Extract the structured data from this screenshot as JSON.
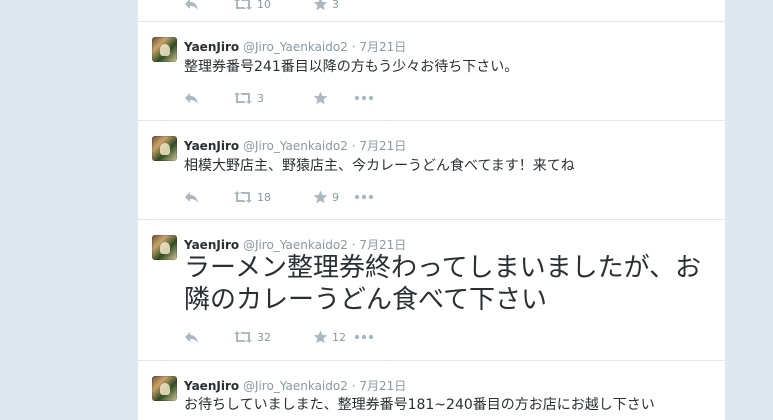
{
  "tweets": [
    {
      "name": "",
      "handle": "",
      "time": "",
      "text": "",
      "retweets": "10",
      "favorites": "3"
    },
    {
      "name": "YaenJiro",
      "handle": "@Jiro_Yaenkaido2",
      "dot": "·",
      "time": "7月21日",
      "text": "整理券番号241番目以降の方もう少々お待ち下さい。",
      "retweets": "3",
      "favorites": ""
    },
    {
      "name": "YaenJiro",
      "handle": "@Jiro_Yaenkaido2",
      "dot": "·",
      "time": "7月21日",
      "text": "相模大野店主、野猿店主、今カレーうどん食べてます！来てね",
      "retweets": "18",
      "favorites": "9"
    },
    {
      "name": "YaenJiro",
      "handle": "@Jiro_Yaenkaido2",
      "dot": "·",
      "time": "7月21日",
      "text": "ラーメン整理券終わってしまいましたが、お隣のカレーうどん食べて下さい",
      "retweets": "32",
      "favorites": "12"
    },
    {
      "name": "YaenJiro",
      "handle": "@Jiro_Yaenkaido2",
      "dot": "·",
      "time": "7月21日",
      "text": "お待ちしていましまた、整理券番号181~240番目の方お店にお越し下さい",
      "retweets": "",
      "favorites": ""
    }
  ],
  "icons": {
    "reply": "reply-icon",
    "retweet": "retweet-icon",
    "favorite": "star-icon",
    "more": "more-icon"
  },
  "colors": {
    "background": "#dde8ef",
    "card": "#ffffff",
    "text": "#292f33",
    "muted": "#8899a6",
    "icon": "#aab8c2",
    "border": "#e1e8ed"
  }
}
